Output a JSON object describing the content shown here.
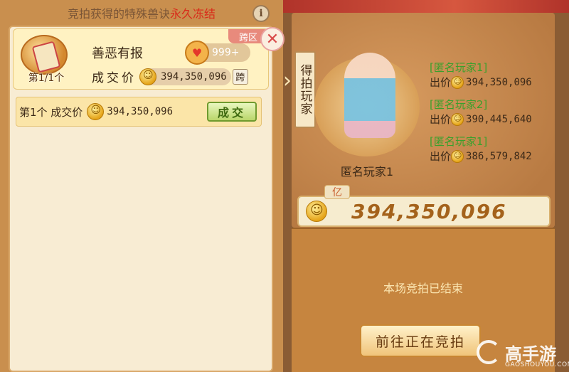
{
  "notice": {
    "prefix": "竞拍获得的特殊兽诀",
    "highlight": "永久冻结"
  },
  "item": {
    "name": "善恶有报",
    "count_label": "第1/1个",
    "cross_tag": "跨区",
    "likes": "999+",
    "deal_label": "成交价",
    "deal_price": "394,350,096",
    "cross_button": "跨"
  },
  "record": {
    "label": "第1个 成交价",
    "price": "394,350,096",
    "status": "成交"
  },
  "winner": {
    "tab_label": "得拍玩家",
    "name": "匿名玩家1"
  },
  "bids": [
    {
      "player": "[匿名玩家1]",
      "label": "出价",
      "price": "394,350,096"
    },
    {
      "player": "[匿名玩家2]",
      "label": "出价",
      "price": "390,445,640"
    },
    {
      "player": "[匿名玩家1]",
      "label": "出价",
      "price": "386,579,842"
    }
  ],
  "final": {
    "unit_tag": "亿",
    "price": "394,350,096"
  },
  "status_text": "本场竞拍已结束",
  "goto_button": "前往正在竞拍",
  "watermark": {
    "brand": "高手游",
    "site": "GAOSHOUYOU.COM"
  },
  "colors": {
    "highlight": "#d92a1a",
    "bidder": "#3aa02c",
    "final_price": "#a4621b"
  }
}
